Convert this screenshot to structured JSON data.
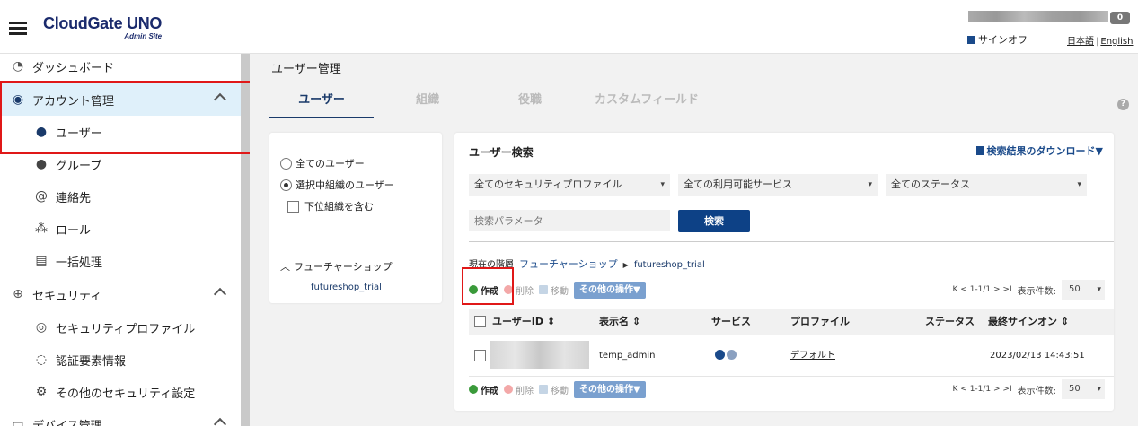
{
  "header": {
    "logo": "CloudGate UNO",
    "logo_sub": "Admin Site",
    "badge_count": "0",
    "signoff": "サインオフ",
    "lang_ja": "日本語",
    "lang_sep": "|",
    "lang_en": "English"
  },
  "sidebar": {
    "items": [
      {
        "label": "ダッシュボード",
        "icon": "dashboard-icon"
      },
      {
        "label": "アカウント管理",
        "icon": "account-icon"
      },
      {
        "label": "ユーザー",
        "icon": "user-icon"
      },
      {
        "label": "グループ",
        "icon": "group-icon"
      },
      {
        "label": "連絡先",
        "icon": "contact-icon"
      },
      {
        "label": "ロール",
        "icon": "role-icon"
      },
      {
        "label": "一括処理",
        "icon": "batch-icon"
      },
      {
        "label": "セキュリティ",
        "icon": "lock-icon"
      },
      {
        "label": "セキュリティプロファイル",
        "icon": "security-profile-icon"
      },
      {
        "label": "認証要素情報",
        "icon": "fingerprint-icon"
      },
      {
        "label": "その他のセキュリティ設定",
        "icon": "other-security-icon"
      },
      {
        "label": "デバイス管理",
        "icon": "device-icon"
      }
    ]
  },
  "main": {
    "page_title": "ユーザー管理",
    "tabs": [
      {
        "label": "ユーザー"
      },
      {
        "label": "組織"
      },
      {
        "label": "役職"
      },
      {
        "label": "カスタムフィールド"
      }
    ],
    "help": "?"
  },
  "left_panel": {
    "radio_all": "全てのユーザー",
    "radio_selected": "選択中組織のユーザー",
    "include_sub": "下位組織を含む",
    "tree_root": "フューチャーショップ",
    "tree_child": "futureshop_trial"
  },
  "search": {
    "title": "ユーザー検索",
    "download": "検索結果のダウンロード▼",
    "filter_profile": "全てのセキュリティプロファイル",
    "filter_service": "全ての利用可能サービス",
    "filter_status": "全てのステータス",
    "param_placeholder": "検索パラメータ",
    "search_button": "検索"
  },
  "hierarchy": {
    "label": "現在の階層",
    "root": "フューチャーショップ",
    "leaf": "futureshop_trial"
  },
  "actions": {
    "create": "作成",
    "delete": "削除",
    "move": "移動",
    "other": "その他の操作▼"
  },
  "pager": {
    "range": "K < 1-1/1 > >I",
    "per_page_label": "表示件数:",
    "per_page_value": "50"
  },
  "table": {
    "headers": [
      "ユーザーID ⇕",
      "表示名 ⇕",
      "サービス",
      "プロファイル",
      "ステータス",
      "最終サインオン ⇕"
    ],
    "rows": [
      {
        "display_name": "temp_admin",
        "profile": "デフォルト",
        "status": "",
        "last_signon": "2023/02/13 14:43:51"
      }
    ]
  },
  "colors": {
    "brand": "#1a2a6c",
    "primary_button": "#0d4186",
    "highlight_red": "#e01818",
    "create_green": "#3a9a3a"
  }
}
